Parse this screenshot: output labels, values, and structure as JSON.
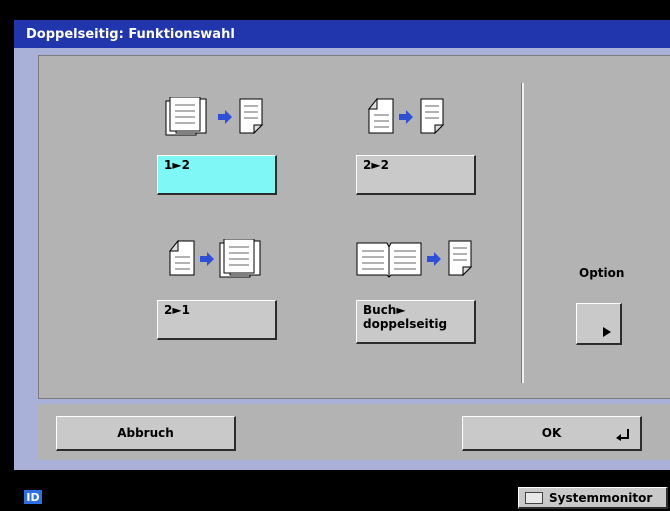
{
  "window": {
    "title": "Doppelseitig: Funktionswahl"
  },
  "modes": [
    {
      "label": "1►2",
      "icon_left": "multiple-pages-icon",
      "icon_right": "duplex-page-icon",
      "selected": true
    },
    {
      "label": "2►2",
      "icon_left": "duplex-page-icon",
      "icon_right": "duplex-page-icon",
      "selected": false
    },
    {
      "label": "2►1",
      "icon_left": "duplex-page-icon",
      "icon_right": "multiple-pages-icon",
      "selected": false
    },
    {
      "label_line1": "Buch►",
      "label_line2": "doppelseitig",
      "icon_left": "open-book-icon",
      "icon_right": "duplex-page-icon",
      "selected": false
    }
  ],
  "option": {
    "label": "Option"
  },
  "footer": {
    "cancel_label": "Abbruch",
    "ok_label": "OK"
  },
  "statusbar": {
    "id_label": "ID",
    "system_monitor_label": "Systemmonitor"
  },
  "colors": {
    "title_bg": "#2135ad",
    "selected_bg": "#7ff7f7",
    "panel_bg": "#b3b3b3",
    "arrow": "#2f4fd6"
  }
}
